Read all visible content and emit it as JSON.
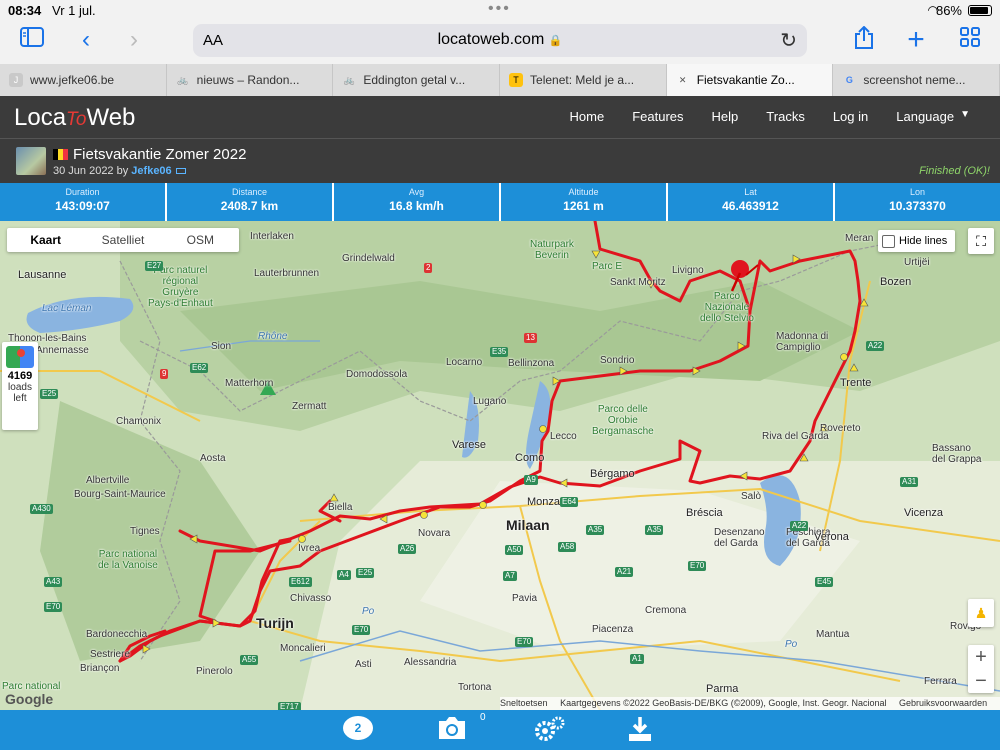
{
  "status_bar": {
    "time": "08:34",
    "date": "Vr 1 jul.",
    "wifi_icon": "wifi-icon",
    "battery": "86%"
  },
  "browser": {
    "text_size": "AA",
    "url": "locatoweb.com",
    "tabs": [
      {
        "title": "www.jefke06.be",
        "icon": "J",
        "color": "#c9c9c9"
      },
      {
        "title": "nieuws – Randon...",
        "icon": "🚲",
        "color": "#e8e8e8"
      },
      {
        "title": "Eddington getal v...",
        "icon": "🚲",
        "color": "#e8e8e8"
      },
      {
        "title": "Telenet: Meld je a...",
        "icon": "T",
        "color": "#ffc20e"
      },
      {
        "title": "Fietsvakantie Zo...",
        "icon": "✕",
        "color": "#f7f7f7"
      },
      {
        "title": "screenshot neme...",
        "icon": "G",
        "color": "#fff"
      }
    ]
  },
  "site": {
    "logo_left": "Loca",
    "logo_to": "To",
    "logo_right": "Web",
    "nav": [
      "Home",
      "Features",
      "Help",
      "Tracks",
      "Log in",
      "Language"
    ]
  },
  "track": {
    "title": "Fietsvakantie Zomer 2022",
    "date_prefix": "30 Jun 2022 by",
    "user": "Jefke06",
    "status": "Finished (OK)!",
    "flag_colors": [
      "#000000",
      "#fdda24",
      "#ef3340"
    ]
  },
  "stats": [
    {
      "label": "Duration",
      "value": "143:09:07"
    },
    {
      "label": "Distance",
      "value": "2408.7 km"
    },
    {
      "label": "Avg",
      "value": "16.8 km/h"
    },
    {
      "label": "Altitude",
      "value": "1261 m"
    },
    {
      "label": "Lat",
      "value": "46.463912"
    },
    {
      "label": "Lon",
      "value": "10.373370"
    }
  ],
  "map": {
    "types": [
      "Kaart",
      "Satelliet",
      "OSM"
    ],
    "hide_lines": "Hide lines",
    "loads_count": "4169",
    "loads_label1": "loads",
    "loads_label2": "left",
    "google": "Google",
    "attribution": [
      "Sneltoetsen",
      "Kaartgegevens ©2022 GeoBasis-DE/BKG (©2009), Google, Inst. Geogr. Nacional",
      "Gebruiksvoorwaarden"
    ],
    "track_color": "#e0141e",
    "zoom_in": "+",
    "zoom_out": "−"
  },
  "bottom": {
    "chat_count": "2",
    "photo_count": "0"
  }
}
